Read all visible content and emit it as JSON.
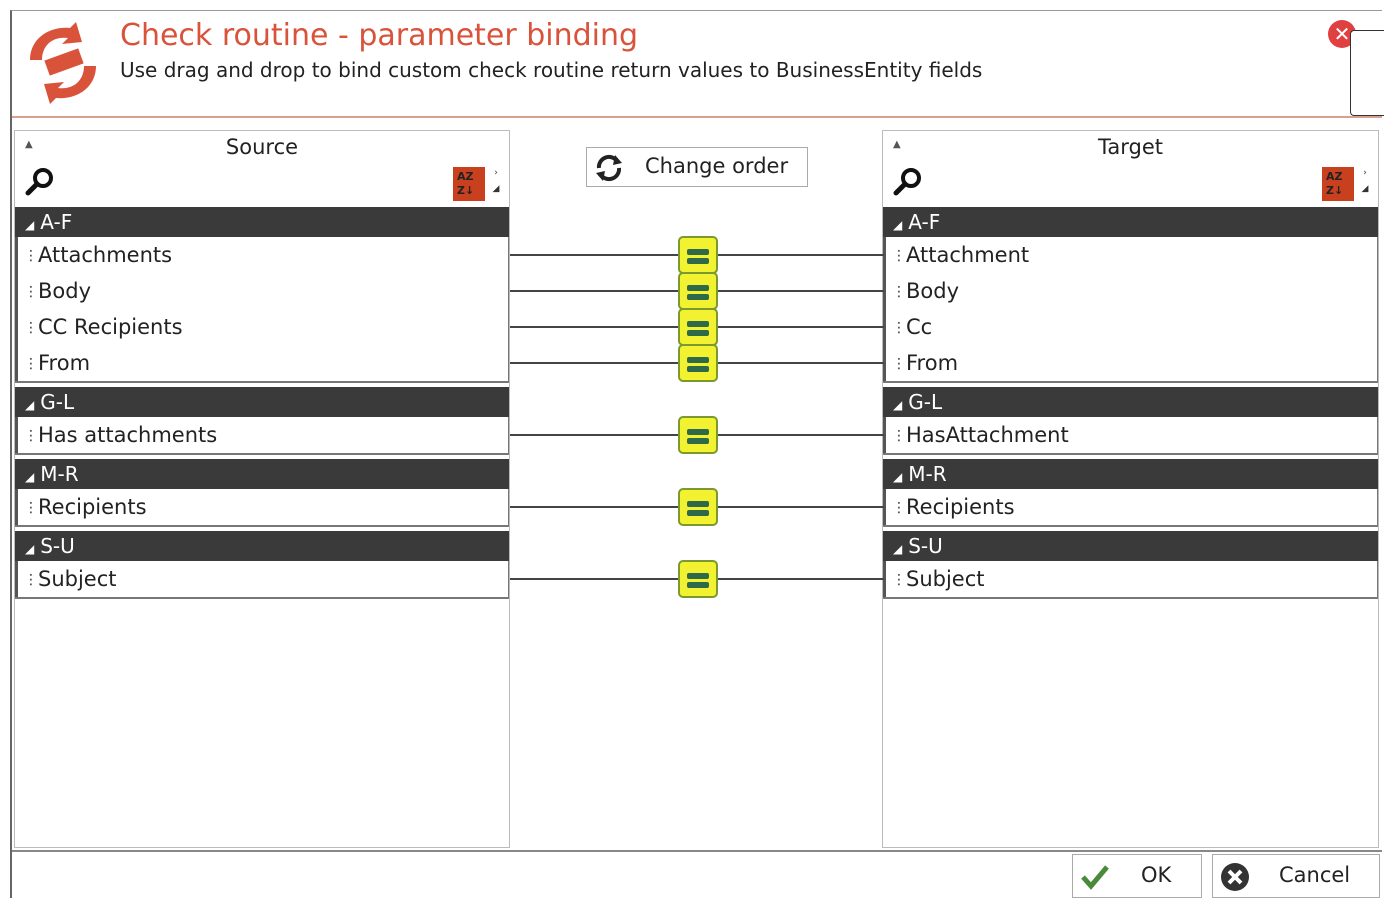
{
  "dialog": {
    "title": "Check routine - parameter binding",
    "subtitle": "Use drag and drop to bind custom check routine return values to BusinessEntity fields",
    "close_icon": "close-icon",
    "accent_color": "#d9533a"
  },
  "source": {
    "title": "Source",
    "groups": [
      {
        "label": "A-F",
        "items": [
          "Attachments",
          "Body",
          "CC Recipients",
          "From"
        ]
      },
      {
        "label": "G-L",
        "items": [
          "Has attachments"
        ]
      },
      {
        "label": "M-R",
        "items": [
          "Recipients"
        ]
      },
      {
        "label": "S-U",
        "items": [
          "Subject"
        ]
      }
    ]
  },
  "target": {
    "title": "Target",
    "groups": [
      {
        "label": "A-F",
        "items": [
          "Attachment",
          "Body",
          "Cc",
          "From"
        ]
      },
      {
        "label": "G-L",
        "items": [
          "HasAttachment"
        ]
      },
      {
        "label": "M-R",
        "items": [
          "Recipients"
        ]
      },
      {
        "label": "S-U",
        "items": [
          "Subject"
        ]
      }
    ]
  },
  "toolbar": {
    "change_order_label": "Change order"
  },
  "bindings": [
    {
      "source": "Attachments",
      "target": "Attachment"
    },
    {
      "source": "Body",
      "target": "Body"
    },
    {
      "source": "CC Recipients",
      "target": "Cc"
    },
    {
      "source": "From",
      "target": "From"
    },
    {
      "source": "Has attachments",
      "target": "HasAttachment"
    },
    {
      "source": "Recipients",
      "target": "Recipients"
    },
    {
      "source": "Subject",
      "target": "Subject"
    }
  ],
  "footer": {
    "ok_label": "OK",
    "cancel_label": "Cancel"
  },
  "colors": {
    "group_header": "#3a3a3a",
    "link_node": "#f2f230",
    "ok_check": "#4a8a3a",
    "cancel": "#333333"
  }
}
